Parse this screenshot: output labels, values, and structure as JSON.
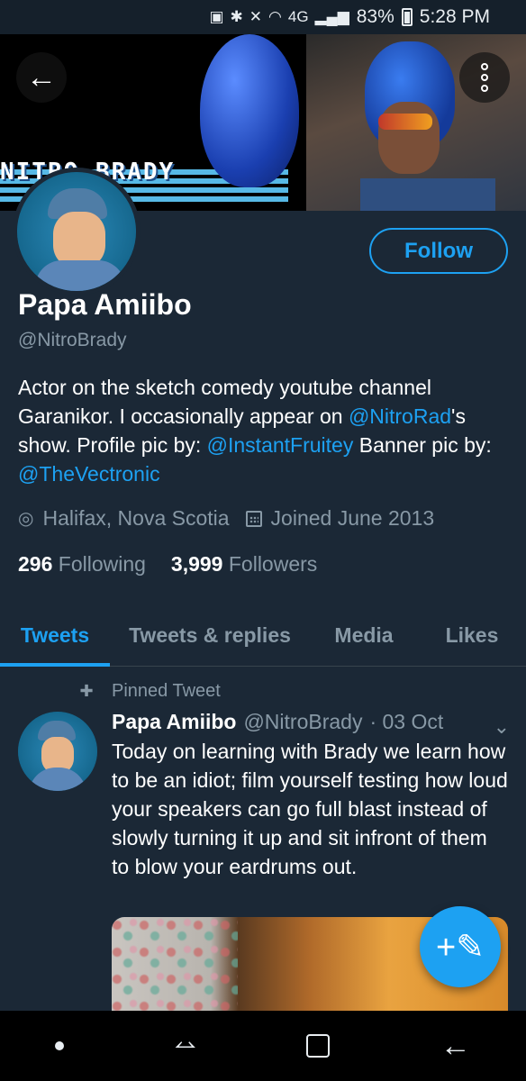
{
  "status_bar": {
    "network": "4G",
    "battery": "83%",
    "time": "5:28 PM"
  },
  "banner": {
    "text": "NITRO BRADY"
  },
  "header": {
    "back_icon": "arrow-left-icon",
    "more_icon": "more-vertical-icon",
    "follow_label": "Follow"
  },
  "profile": {
    "display_name": "Papa Amiibo",
    "handle": "@NitroBrady",
    "bio": {
      "part1": "Actor on the sketch comedy youtube channel Garanikor. I occasionally appear on ",
      "link1": "@NitroRad",
      "part2": "'s show. Profile pic by: ",
      "link2": "@InstantFruitey",
      "part3": " Banner pic by: ",
      "link3": "@TheVectronic"
    },
    "location": "Halifax, Nova Scotia",
    "joined": "Joined June 2013",
    "following_count": "296",
    "following_label": "Following",
    "followers_count": "3,999",
    "followers_label": "Followers"
  },
  "tabs": [
    {
      "label": "Tweets",
      "active": true
    },
    {
      "label": "Tweets & replies",
      "active": false
    },
    {
      "label": "Media",
      "active": false
    },
    {
      "label": "Likes",
      "active": false
    }
  ],
  "pinned_tweet": {
    "pinned_label": "Pinned Tweet",
    "name": "Papa Amiibo",
    "handle": "@NitroBrady",
    "date": "· 03 Oct",
    "text": "Today on learning with Brady we learn how to be an idiot; film yourself testing how loud your speakers can go full blast instead of slowly turning it up and sit infront of them to blow your eardrums out."
  },
  "fab": {
    "icon": "compose-tweet-icon"
  },
  "colors": {
    "background": "#1b2836",
    "accent": "#1da1f2",
    "secondary_text": "#8899a6"
  }
}
